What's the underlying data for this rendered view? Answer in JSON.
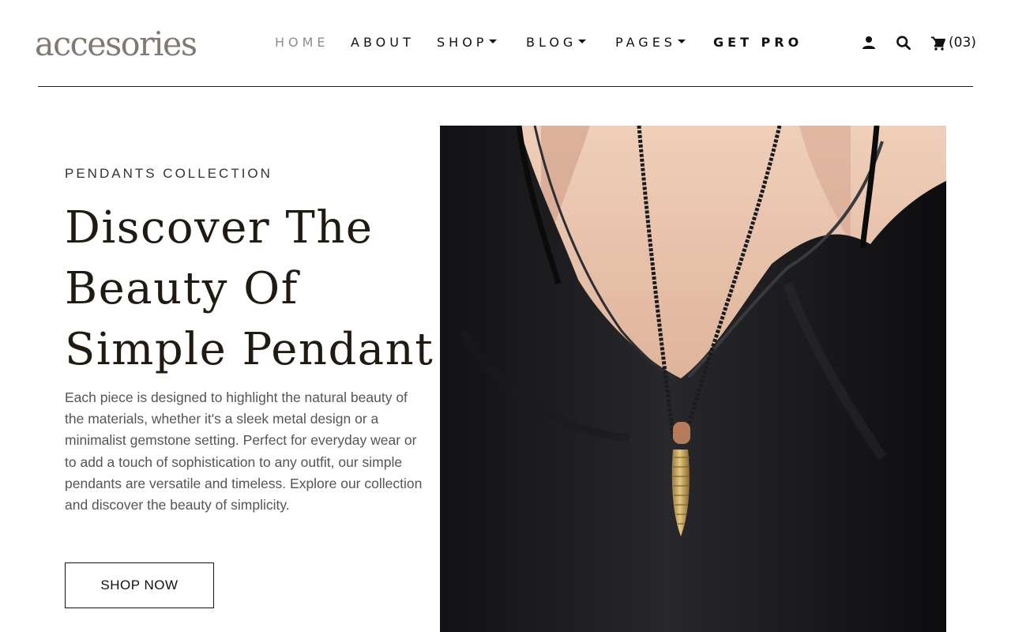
{
  "brand": {
    "logo_text": "accesories"
  },
  "nav": {
    "items": [
      {
        "label": "HOME",
        "active": true,
        "dropdown": false
      },
      {
        "label": "ABOUT",
        "active": false,
        "dropdown": false
      },
      {
        "label": "SHOP",
        "active": false,
        "dropdown": true
      },
      {
        "label": "BLOG",
        "active": false,
        "dropdown": true
      },
      {
        "label": "PAGES",
        "active": false,
        "dropdown": true
      },
      {
        "label": "GET PRO",
        "active": false,
        "dropdown": false
      }
    ]
  },
  "header_icons": {
    "account": "user-icon",
    "search": "search-icon",
    "cart": "cart-icon"
  },
  "cart": {
    "count": "(03)"
  },
  "hero": {
    "eyebrow": "PENDANTS COLLECTION",
    "title_lines": [
      "Discover The",
      "Beauty Of",
      "Simple Pendant"
    ],
    "description": "Each piece is designed to highlight the natural beauty of the materials, whether it's a sleek metal design or a minimalist gemstone setting. Perfect for everyday wear or to add a touch of sophistication to any outfit, our simple pendants are versatile and timeless. Explore our collection and discover the beauty of simplicity.",
    "cta_label": "SHOP NOW"
  },
  "colors": {
    "text": "#1f1a12",
    "muted": "#8d8d8d",
    "body_text": "#555555",
    "rule": "#1a1a1a",
    "background": "#ffffff"
  }
}
